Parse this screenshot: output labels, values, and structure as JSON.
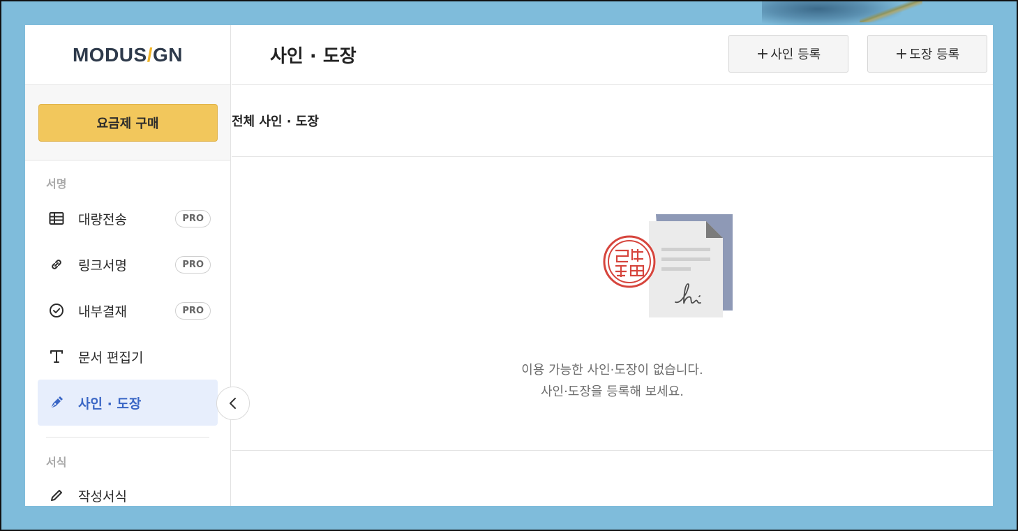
{
  "brand": {
    "logo_left": "MODUS",
    "logo_slash": "/",
    "logo_right": "GN",
    "accent_color": "#f0b429"
  },
  "sidebar": {
    "buy_button_label": "요금제 구매",
    "section_sign": "서명",
    "section_forms": "서식",
    "items": [
      {
        "label": "대량전송",
        "icon": "table-icon",
        "badge": "PRO"
      },
      {
        "label": "링크서명",
        "icon": "link-icon",
        "badge": "PRO"
      },
      {
        "label": "내부결재",
        "icon": "check-circle-icon",
        "badge": "PRO"
      },
      {
        "label": "문서 편집기",
        "icon": "text-icon"
      },
      {
        "label": "사인 · 도장",
        "icon": "pen-icon",
        "active": true
      },
      {
        "label": "작성서식",
        "icon": "pencil-icon"
      }
    ]
  },
  "header": {
    "title": "사인 · 도장",
    "register_sign_label": "사인 등록",
    "register_stamp_label": "도장 등록",
    "plus": "+"
  },
  "content": {
    "filter_title": "전체 사인 · 도장",
    "empty_line1": "이용 가능한 사인·도장이 없습니다.",
    "empty_line2": "사인·도장을 등록해 보세요."
  },
  "colors": {
    "active_bg": "#e7eefc",
    "active_text": "#3a66c5",
    "buy_button": "#f2c75c",
    "stamp_red": "#d6453d",
    "doc_back": "#8e99b6"
  }
}
